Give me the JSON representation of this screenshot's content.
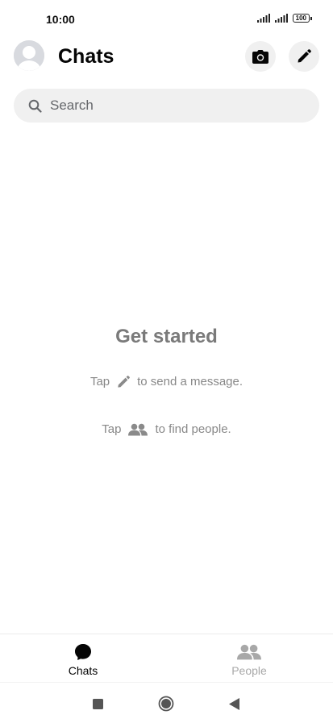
{
  "status_bar": {
    "time": "10:00",
    "battery": "100"
  },
  "header": {
    "title": "Chats",
    "avatar_icon": "avatar-placeholder-icon",
    "camera_icon": "camera-icon",
    "compose_icon": "pencil-icon"
  },
  "search": {
    "placeholder": "Search",
    "value": ""
  },
  "empty_state": {
    "title": "Get started",
    "hint_compose_prefix": "Tap",
    "hint_compose_suffix": "to send a message.",
    "hint_people_prefix": "Tap",
    "hint_people_suffix": "to find people."
  },
  "bottom_nav": {
    "tabs": [
      {
        "label": "Chats",
        "icon": "chat-bubble-icon",
        "active": true
      },
      {
        "label": "People",
        "icon": "people-icon",
        "active": false
      }
    ]
  },
  "system_nav": {
    "buttons": [
      "recents-icon",
      "home-icon",
      "back-icon"
    ]
  },
  "colors": {
    "title_text": "#050505",
    "muted_text": "#888888",
    "search_bg": "#f0f0f0",
    "inactive_tab": "#a8a8a8"
  }
}
